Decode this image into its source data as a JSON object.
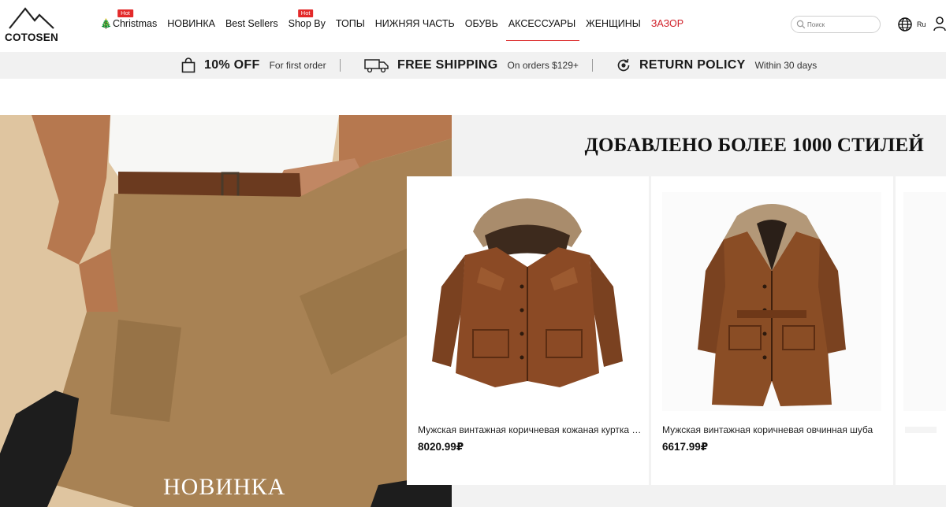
{
  "brand": {
    "name": "COTOSEN"
  },
  "nav": {
    "items": [
      {
        "label": "Christmas",
        "badge": "Hot",
        "icon": "tree-icon"
      },
      {
        "label": "НОВИНКА"
      },
      {
        "label": "Best Sellers"
      },
      {
        "label": "Shop By",
        "badge": "Hot"
      },
      {
        "label": "ТОПЫ"
      },
      {
        "label": "НИЖНЯЯ ЧАСТЬ"
      },
      {
        "label": "ОБУВЬ"
      },
      {
        "label": "АКСЕССУАРЫ",
        "active": true
      },
      {
        "label": "ЖЕНЩИНЫ"
      },
      {
        "label": "ЗАЗОР",
        "color": "#d01f28"
      }
    ]
  },
  "search": {
    "placeholder": "Поиск"
  },
  "language": {
    "code": "Ru"
  },
  "promo": {
    "items": [
      {
        "title": "10% OFF",
        "subtitle": "For first order",
        "icon": "bag-icon"
      },
      {
        "title": "FREE SHIPPING",
        "subtitle": "On orders $129+",
        "icon": "truck-icon"
      },
      {
        "title": "RETURN POLICY",
        "subtitle": "Within 30 days",
        "icon": "return-icon"
      }
    ]
  },
  "hero": {
    "banner_title": "НОВИНКА",
    "heading": "ДОБАВЛЕНО БОЛЕЕ 1000 СТИЛЕЙ"
  },
  "products": [
    {
      "name": "Мужская винтажная коричневая кожаная куртка с капюшоном",
      "price": "8020.99₽"
    },
    {
      "name": "Мужская винтажная коричневая овчинная шуба",
      "price": "6617.99₽"
    }
  ],
  "colors": {
    "accent": "#e32a2a",
    "sale": "#d01f28",
    "banner_bg": "#e2c9a4",
    "leather": "#7a4322"
  }
}
